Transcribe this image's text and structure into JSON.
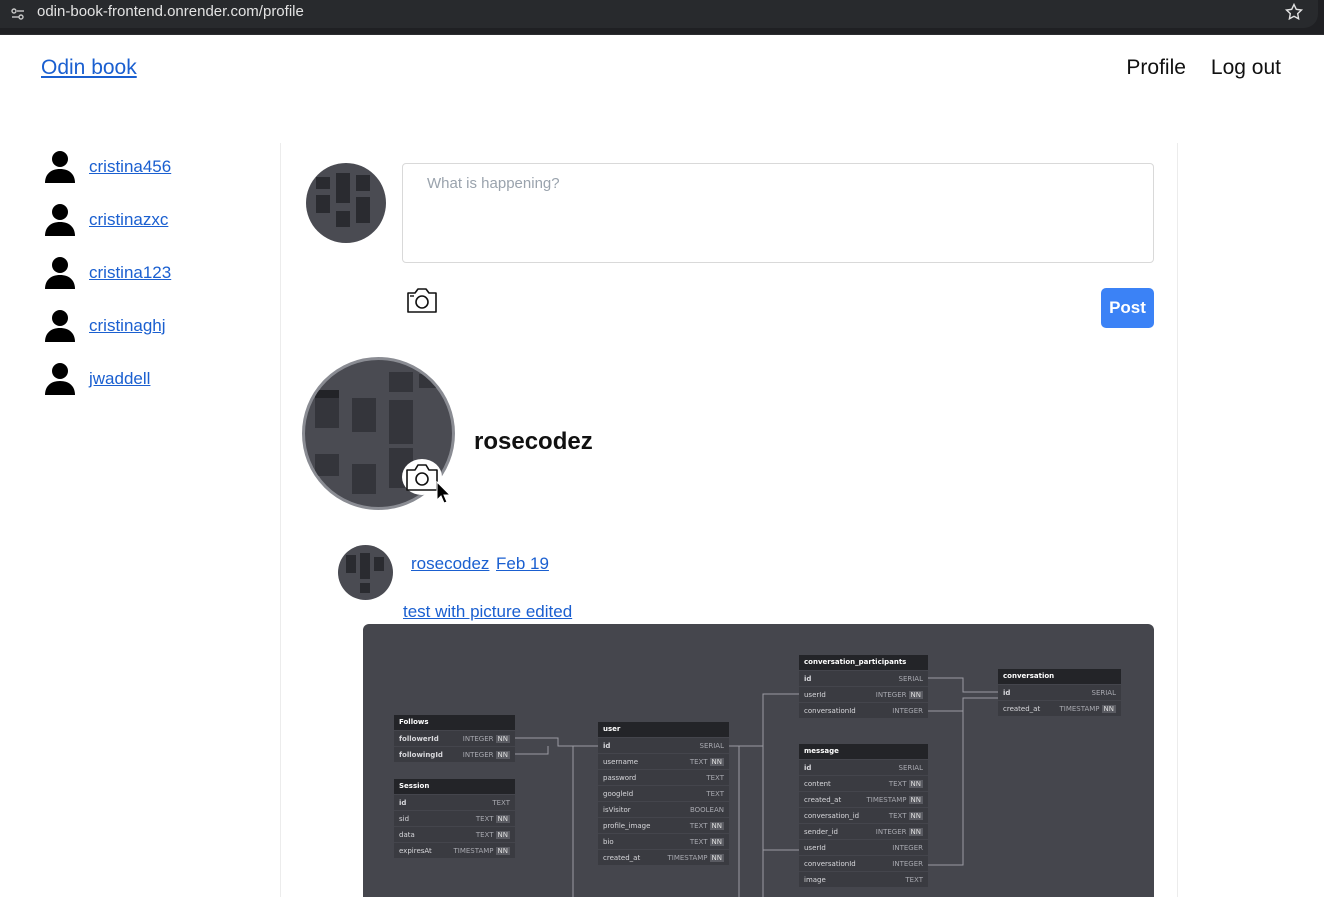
{
  "browser": {
    "url": "odin-book-frontend.onrender.com/profile"
  },
  "header": {
    "brand": "Odin book",
    "nav": {
      "profile": "Profile",
      "logout": "Log out"
    }
  },
  "sidebar": {
    "users": [
      {
        "name": "cristina456"
      },
      {
        "name": "cristinazxc"
      },
      {
        "name": "cristina123"
      },
      {
        "name": "cristinaghj"
      },
      {
        "name": "jwaddell"
      }
    ]
  },
  "composer": {
    "placeholder": "What is happening?",
    "post_label": "Post"
  },
  "profile": {
    "username": "rosecodez"
  },
  "post": {
    "author": "rosecodez",
    "date": "Feb 19",
    "text": "test with picture edited"
  },
  "diagram": {
    "tables": [
      {
        "name": "Follows",
        "rows": [
          [
            "followerId",
            "INTEGER",
            "NN"
          ],
          [
            "followingId",
            "INTEGER",
            "NN"
          ]
        ]
      },
      {
        "name": "Session",
        "rows": [
          [
            "id",
            "TEXT",
            ""
          ],
          [
            "sid",
            "TEXT",
            "NN"
          ],
          [
            "data",
            "TEXT",
            "NN"
          ],
          [
            "expiresAt",
            "TIMESTAMP",
            "NN"
          ]
        ]
      },
      {
        "name": "user",
        "rows": [
          [
            "id",
            "SERIAL",
            ""
          ],
          [
            "username",
            "TEXT",
            "NN"
          ],
          [
            "password",
            "TEXT",
            ""
          ],
          [
            "googleId",
            "TEXT",
            ""
          ],
          [
            "isVisitor",
            "BOOLEAN",
            ""
          ],
          [
            "profile_image",
            "TEXT",
            "NN"
          ],
          [
            "bio",
            "TEXT",
            "NN"
          ],
          [
            "created_at",
            "TIMESTAMP",
            "NN"
          ]
        ]
      },
      {
        "name": "conversation_participants",
        "rows": [
          [
            "id",
            "SERIAL",
            ""
          ],
          [
            "userId",
            "INTEGER",
            "NN"
          ],
          [
            "conversationId",
            "INTEGER",
            ""
          ]
        ]
      },
      {
        "name": "message",
        "rows": [
          [
            "id",
            "SERIAL",
            ""
          ],
          [
            "content",
            "TEXT",
            "NN"
          ],
          [
            "created_at",
            "TIMESTAMP",
            "NN"
          ],
          [
            "conversation_id",
            "TEXT",
            "NN"
          ],
          [
            "sender_id",
            "INTEGER",
            "NN"
          ],
          [
            "userId",
            "INTEGER",
            ""
          ],
          [
            "conversationId",
            "INTEGER",
            ""
          ],
          [
            "image",
            "TEXT",
            ""
          ]
        ]
      },
      {
        "name": "conversation",
        "rows": [
          [
            "id",
            "SERIAL",
            ""
          ],
          [
            "created_at",
            "TIMESTAMP",
            "NN"
          ]
        ]
      }
    ]
  }
}
